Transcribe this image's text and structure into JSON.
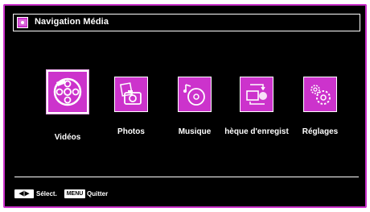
{
  "header": {
    "title": "Navigation Média",
    "icon": "media-folder-icon"
  },
  "menu": {
    "items": [
      {
        "label": "Vidéos",
        "icon": "film-reel-icon",
        "selected": true
      },
      {
        "label": "Photos",
        "icon": "camera-photo-icon",
        "selected": false
      },
      {
        "label": "Musique",
        "icon": "music-disc-icon",
        "selected": false
      },
      {
        "label": "hèque d'enregist",
        "icon": "recordings-icon",
        "selected": false
      },
      {
        "label": "Réglages",
        "icon": "gears-icon",
        "selected": false
      }
    ]
  },
  "footer": {
    "select_key": "◀|▶",
    "select_label": "Sélect.",
    "menu_key": "MENU",
    "quit_label": "Quitter"
  },
  "colors": {
    "accent": "#cc33cc",
    "background": "#000000",
    "text": "#ffffff"
  }
}
